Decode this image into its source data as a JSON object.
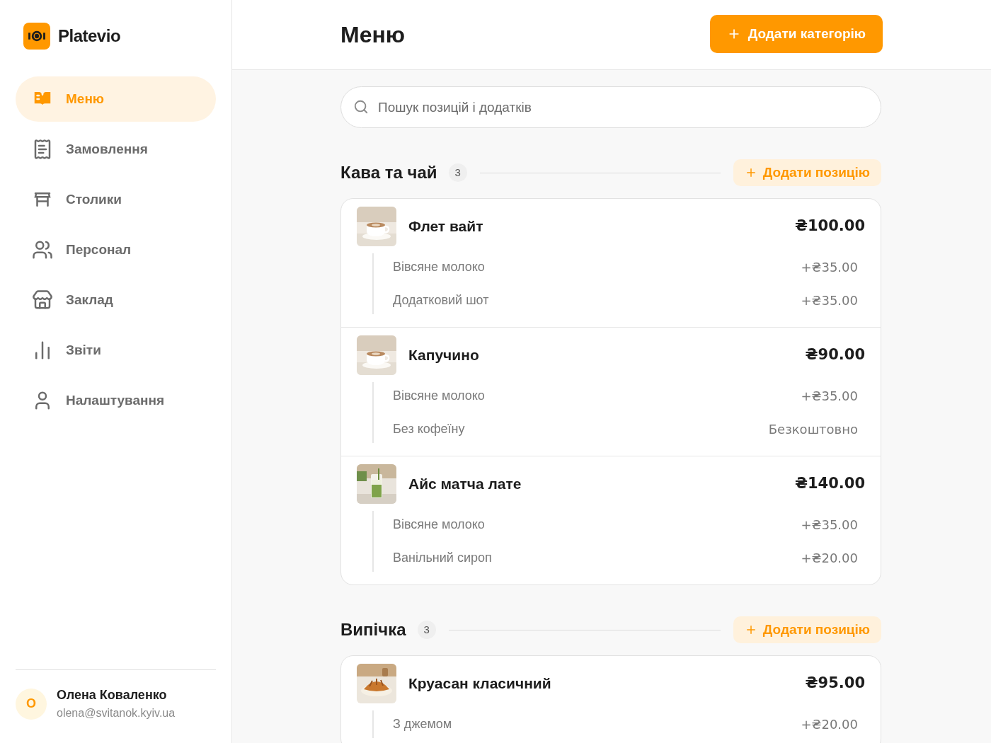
{
  "brand": {
    "name": "Platevio"
  },
  "nav": [
    {
      "label": "Меню",
      "selected": true
    },
    {
      "label": "Замовлення",
      "selected": false
    },
    {
      "label": "Столики",
      "selected": false
    },
    {
      "label": "Персонал",
      "selected": false
    },
    {
      "label": "Заклад",
      "selected": false
    },
    {
      "label": "Звіти",
      "selected": false
    },
    {
      "label": "Налаштування",
      "selected": false
    }
  ],
  "user": {
    "initial": "О",
    "name": "Олена Коваленко",
    "email": "olena@svitanok.kyiv.ua"
  },
  "header": {
    "title": "Меню",
    "add_category": "Додати категорію"
  },
  "search": {
    "placeholder": "Пошук позицій і додатків"
  },
  "categories": [
    {
      "name": "Кава та чай",
      "count": "3",
      "add_item": "Додати позицію",
      "items": [
        {
          "name": "Флет вайт",
          "price": "₴100.00",
          "image": {
            "kind": "picture"
          },
          "addons": [
            {
              "name": "Вівсяне молоко",
              "price": "+₴35.00"
            },
            {
              "name": "Додатковий шот",
              "price": "+₴35.00"
            }
          ]
        },
        {
          "name": "Капучино",
          "price": "₴90.00",
          "image": {
            "kind": "picture"
          },
          "addons": [
            {
              "name": "Вівсяне молоко",
              "price": "+₴35.00"
            },
            {
              "name": "Без кофеїну",
              "price": "Безкоштовно"
            }
          ]
        },
        {
          "name": "Айс матча лате",
          "price": "₴140.00",
          "image": {
            "kind": "picture"
          },
          "addons": [
            {
              "name": "Вівсяне молоко",
              "price": "+₴35.00"
            },
            {
              "name": "Ванільний сироп",
              "price": "+₴20.00"
            }
          ]
        }
      ]
    },
    {
      "name": "Випічка",
      "count": "3",
      "add_item": "Додати позицію",
      "items": [
        {
          "name": "Круасан класичний",
          "price": "₴95.00",
          "image": {
            "kind": "picture"
          },
          "addons": [
            {
              "name": "З джемом",
              "price": "+₴20.00"
            }
          ]
        }
      ]
    }
  ]
}
